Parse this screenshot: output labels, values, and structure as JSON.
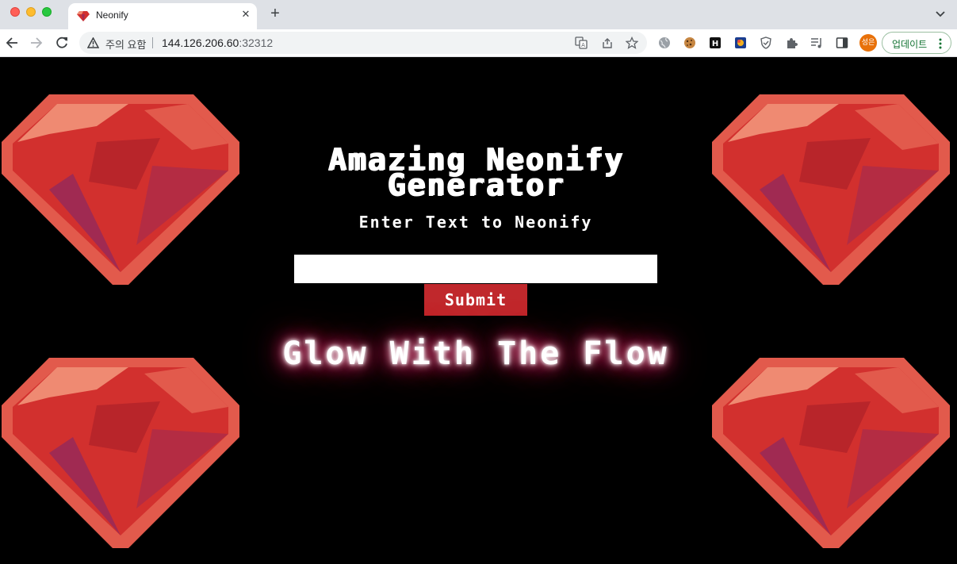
{
  "browser": {
    "tab_title": "Neonify",
    "tab_close": "✕",
    "new_tab": "+",
    "security_warning": "주의 요함",
    "url_host": "144.126.206.60",
    "url_port": ":32312",
    "profile_initials": "성은",
    "update_label": "업데이트"
  },
  "page": {
    "title": "Amazing Neonify Generator",
    "subtitle": "Enter Text to Neonify",
    "input_value": "",
    "submit_label": "Submit",
    "neon_output": "Glow With The Flow"
  },
  "colors": {
    "background": "#000000",
    "submit": "#c0282c",
    "neon_glow": "#ff2a6d",
    "gem_light": "#e25a4c",
    "gem_mid": "#d2302e",
    "gem_dark": "#a02a52",
    "gem_highlight": "#ef8a72"
  },
  "icons": {
    "gem": "ruby-gem-icon"
  }
}
